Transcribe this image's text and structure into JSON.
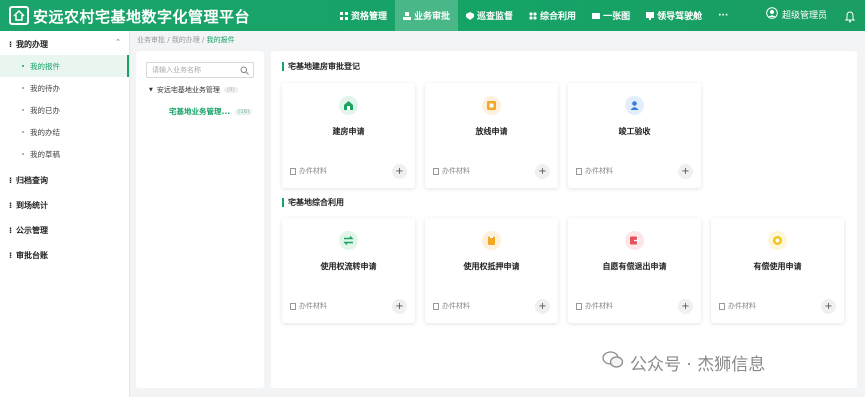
{
  "header": {
    "title": "安远农村宅基地数字化管理平台",
    "nav": [
      {
        "label": "资格管理",
        "icon": "grid-icon"
      },
      {
        "label": "业务审批",
        "icon": "stamp-icon",
        "active": true
      },
      {
        "label": "巡查监督",
        "icon": "shield-icon"
      },
      {
        "label": "综合利用",
        "icon": "apps-icon"
      },
      {
        "label": "一张图",
        "icon": "map-icon"
      },
      {
        "label": "领导驾驶舱",
        "icon": "dashboard-icon"
      },
      {
        "label": "···",
        "icon": ""
      }
    ],
    "user": "超级管理员"
  },
  "sidebar": {
    "groups": [
      {
        "label": "我的办理",
        "expanded": true,
        "items": [
          "我的报件",
          "我的待办",
          "我的已办",
          "我的办结",
          "我的草稿"
        ],
        "active_index": 0
      },
      {
        "label": "归档查询"
      },
      {
        "label": "到场统计"
      },
      {
        "label": "公示管理"
      },
      {
        "label": "审批台账"
      }
    ]
  },
  "breadcrumb": {
    "parts": [
      "业务审批",
      "我的办理",
      "我的报件"
    ],
    "sep": " / "
  },
  "tree": {
    "search_placeholder": "请输入业务名称",
    "root": "安远宅基地业务管理",
    "root_badge": "(9)",
    "child": "宅基地业务管理...",
    "child_badge": "(16)"
  },
  "sections": [
    {
      "title": "宅基地建房审批登记",
      "cards": [
        {
          "title": "建房申请",
          "icon": "house-icon",
          "color": "#19a463",
          "footer": "办件材料"
        },
        {
          "title": "放线申请",
          "icon": "ruler-icon",
          "color": "#f5a623",
          "footer": "办件材料"
        },
        {
          "title": "竣工验收",
          "icon": "inspector-icon",
          "color": "#3a7be0",
          "footer": "办件材料"
        }
      ]
    },
    {
      "title": "宅基地综合利用",
      "cards": [
        {
          "title": "使用权流转申请",
          "icon": "transfer-icon",
          "color": "#19a463",
          "footer": "办件材料"
        },
        {
          "title": "使用权抵押申请",
          "icon": "mortgage-icon",
          "color": "#f5a623",
          "footer": "办件材料"
        },
        {
          "title": "自愿有偿退出申请",
          "icon": "exit-icon",
          "color": "#e8505b",
          "footer": "办件材料"
        },
        {
          "title": "有偿使用申请",
          "icon": "coin-icon",
          "color": "#f0c419",
          "footer": "办件材料"
        }
      ]
    }
  ],
  "watermark": "公众号 · 杰狮信息"
}
